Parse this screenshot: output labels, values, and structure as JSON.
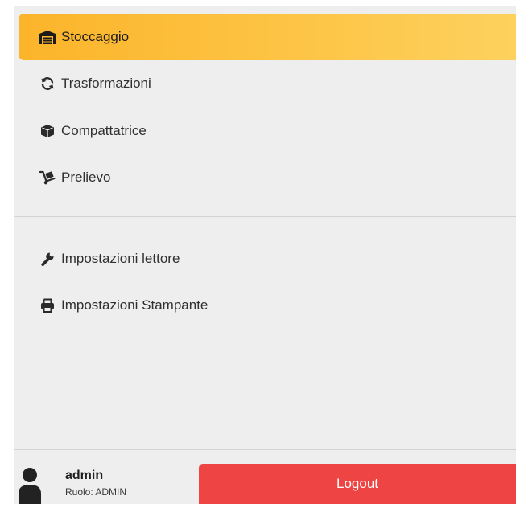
{
  "nav": {
    "primary": [
      {
        "label": "Stoccaggio",
        "icon": "warehouse-icon",
        "active": true
      },
      {
        "label": "Trasformazioni",
        "icon": "sync-icon",
        "active": false
      },
      {
        "label": "Compattatrice",
        "icon": "box-icon",
        "active": false
      },
      {
        "label": "Prelievo",
        "icon": "dolly-icon",
        "active": false
      }
    ],
    "secondary": [
      {
        "label": "Impostazioni lettore",
        "icon": "wrench-icon"
      },
      {
        "label": "Impostazioni Stampante",
        "icon": "printer-icon"
      }
    ]
  },
  "user": {
    "name": "admin",
    "role": "Ruolo: ADMIN",
    "avatar_icon": "user-icon"
  },
  "actions": {
    "logout_label": "Logout"
  },
  "colors": {
    "sidebar_bg": "#eeeeee",
    "active_gradient_start": "#fcb42a",
    "active_gradient_end": "#fdd15e",
    "logout_bg": "#ef4444",
    "text": "#303030"
  }
}
